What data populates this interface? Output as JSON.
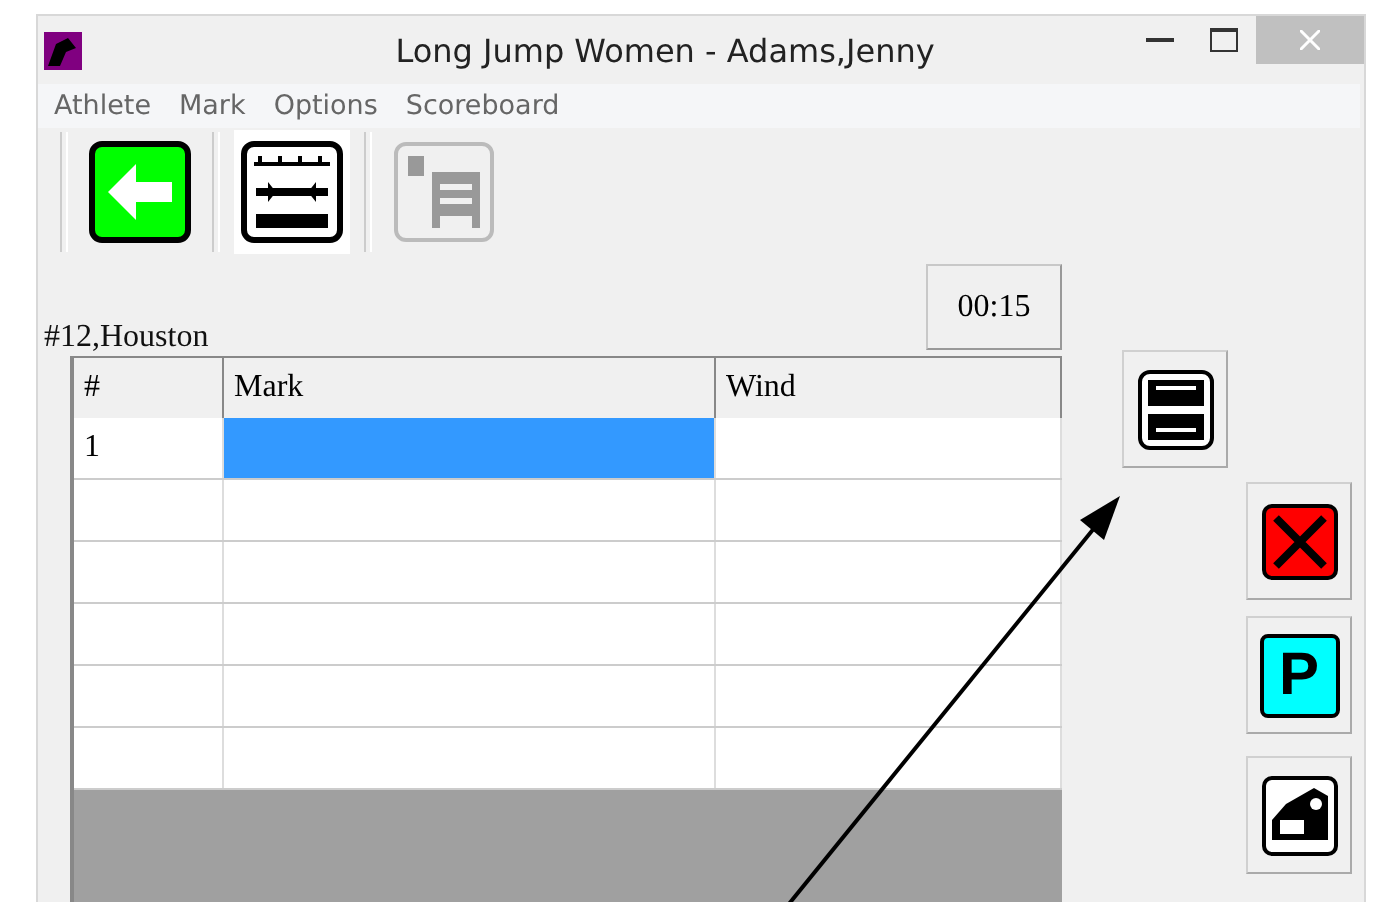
{
  "window": {
    "title": "Long Jump Women - Adams,Jenny"
  },
  "menu": [
    "Athlete",
    "Mark",
    "Options",
    "Scoreboard"
  ],
  "toolbar": [
    {
      "kind": "back",
      "disabled": false
    },
    {
      "kind": "measure",
      "disabled": false
    },
    {
      "kind": "load",
      "disabled": true
    }
  ],
  "athlete": "#12,Houston",
  "timer": "00:15",
  "table": {
    "columns": [
      "#",
      "Mark",
      "Wind"
    ],
    "rows": [
      {
        "cells": [
          {
            "text": "1",
            "selected": false
          },
          {
            "text": "",
            "selected": true
          },
          {
            "text": "",
            "selected": false
          }
        ]
      },
      {
        "cells": [
          {
            "text": "",
            "selected": false
          },
          {
            "text": "",
            "selected": false
          },
          {
            "text": "",
            "selected": false
          }
        ]
      },
      {
        "cells": [
          {
            "text": "",
            "selected": false
          },
          {
            "text": "",
            "selected": false
          },
          {
            "text": "",
            "selected": false
          }
        ]
      },
      {
        "cells": [
          {
            "text": "",
            "selected": false
          },
          {
            "text": "",
            "selected": false
          },
          {
            "text": "",
            "selected": false
          }
        ]
      },
      {
        "cells": [
          {
            "text": "",
            "selected": false
          },
          {
            "text": "",
            "selected": false
          },
          {
            "text": "",
            "selected": false
          }
        ]
      },
      {
        "cells": [
          {
            "text": "",
            "selected": false
          },
          {
            "text": "",
            "selected": false
          },
          {
            "text": "",
            "selected": false
          }
        ]
      }
    ]
  },
  "side_buttons": [
    {
      "kind": "tape"
    },
    {
      "kind": "foul"
    },
    {
      "kind": "pass",
      "label": "P"
    },
    {
      "kind": "print"
    }
  ]
}
